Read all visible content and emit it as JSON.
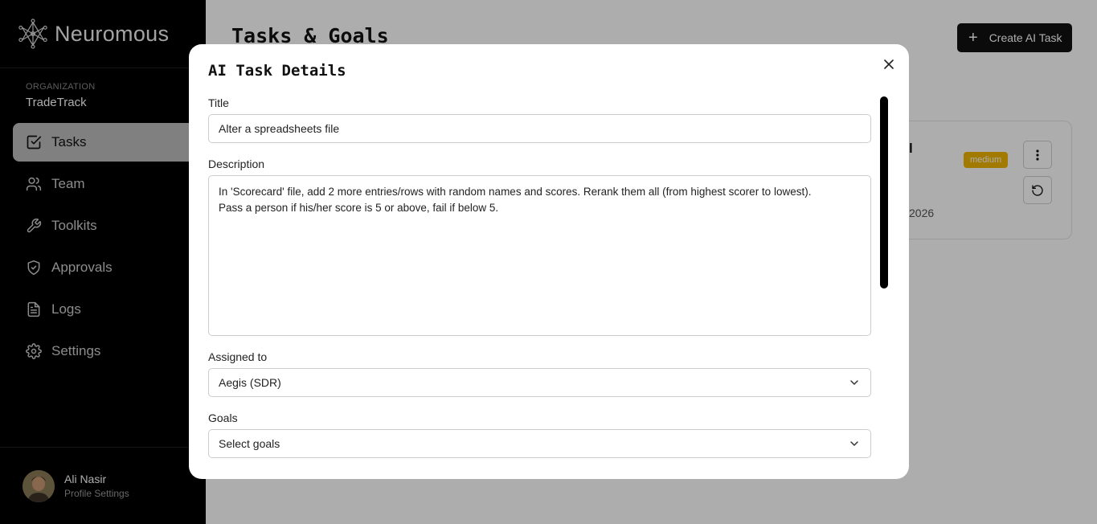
{
  "sidebar": {
    "brand": "Neuromous",
    "org_label": "ORGANIZATION",
    "org_name": "TradeTrack",
    "items": [
      {
        "label": "Tasks",
        "icon": "checkbox-icon",
        "active": true
      },
      {
        "label": "Team",
        "icon": "users-icon",
        "active": false
      },
      {
        "label": "Toolkits",
        "icon": "wrench-icon",
        "active": false
      },
      {
        "label": "Approvals",
        "icon": "shield-check-icon",
        "active": false
      },
      {
        "label": "Logs",
        "icon": "document-icon",
        "active": false
      },
      {
        "label": "Settings",
        "icon": "gear-icon",
        "active": false
      }
    ],
    "profile": {
      "name": "Ali Nasir",
      "link": "Profile Settings"
    }
  },
  "main": {
    "title": "Tasks & Goals",
    "create_button": "Create AI Task",
    "card": {
      "title_fragment": "l",
      "priority": "medium",
      "date_fragment": "2026"
    }
  },
  "modal": {
    "title": "AI Task Details",
    "title_label": "Title",
    "title_value": "Alter a spreadsheets file",
    "description_label": "Description",
    "description_line1": "In 'Scorecard' file, add 2 more entries/rows with random names and scores. Rerank them all (from highest scorer to lowest).",
    "description_line2": "Pass a person if his/her score is 5 or above, fail if below 5.",
    "assigned_label": "Assigned to",
    "assigned_value": "Aegis (SDR)",
    "goals_label": "Goals",
    "goals_placeholder": "Select goals"
  },
  "colors": {
    "sidebar_bg": "#000000",
    "active_nav_bg": "#bdbdbd",
    "badge_medium": "#f0b400",
    "primary_button": "#111111"
  }
}
